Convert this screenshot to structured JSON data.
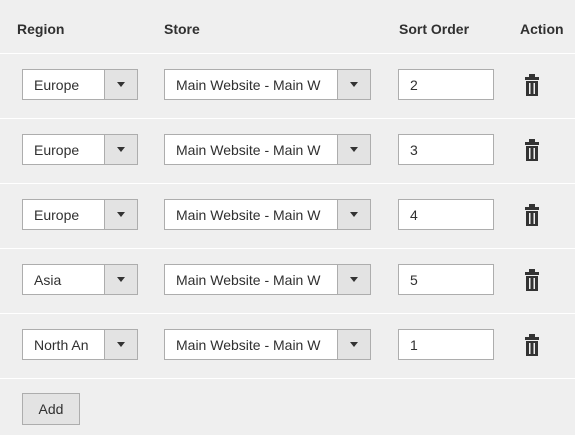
{
  "columns": {
    "region": "Region",
    "store": "Store",
    "sort_order": "Sort Order",
    "action": "Action"
  },
  "rows": [
    {
      "region": "Europe",
      "store": "Main Website - Main W",
      "sort_order": "2"
    },
    {
      "region": "Europe",
      "store": "Main Website - Main W",
      "sort_order": "3"
    },
    {
      "region": "Europe",
      "store": "Main Website - Main W",
      "sort_order": "4"
    },
    {
      "region": "Asia",
      "store": "Main Website - Main W",
      "sort_order": "5"
    },
    {
      "region": "North An",
      "store": "Main Website - Main W",
      "sort_order": "1"
    }
  ],
  "add_label": "Add",
  "icons": {
    "dropdown": "chevron-down-icon",
    "delete": "trash-icon"
  },
  "colors": {
    "background": "#efefef",
    "border": "#adadad",
    "text": "#303030"
  }
}
